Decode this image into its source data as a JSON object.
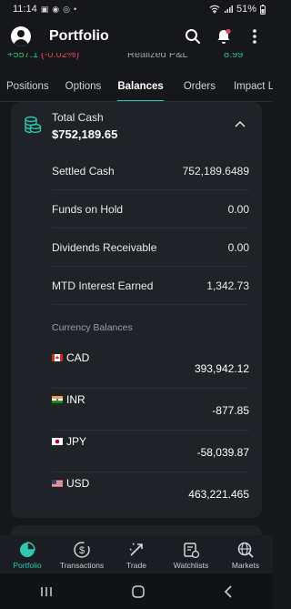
{
  "status_bar": {
    "time": "11:14",
    "battery": "51%"
  },
  "header": {
    "title": "Portfolio"
  },
  "ticker": {
    "gain": "+557.1",
    "pct": "(-0.02%)",
    "label": "Realized P&L",
    "value": "8.99"
  },
  "tabs": [
    {
      "label": "Positions"
    },
    {
      "label": "Options"
    },
    {
      "label": "Balances"
    },
    {
      "label": "Orders"
    },
    {
      "label": "Impact Len"
    }
  ],
  "balances": {
    "total_label": "Total Cash",
    "total_value": "$752,189.65",
    "rows": [
      {
        "label": "Settled Cash",
        "value": "752,189.6489"
      },
      {
        "label": "Funds on Hold",
        "value": "0.00"
      },
      {
        "label": "Dividends Receivable",
        "value": "0.00"
      },
      {
        "label": "MTD Interest Earned",
        "value": "1,342.73"
      }
    ],
    "currency_section_label": "Currency Balances",
    "currencies": [
      {
        "code": "CAD",
        "amount": "393,942.12"
      },
      {
        "code": "INR",
        "amount": "-877.85"
      },
      {
        "code": "JPY",
        "amount": "-58,039.87"
      },
      {
        "code": "USD",
        "amount": "463,221.465"
      }
    ]
  },
  "bottom_nav": [
    {
      "label": "Portfolio",
      "icon": "pie-chart-icon"
    },
    {
      "label": "Transactions",
      "icon": "dollar-circle-icon"
    },
    {
      "label": "Trade",
      "icon": "trade-arrows-icon"
    },
    {
      "label": "Watchlists",
      "icon": "watchlist-icon"
    },
    {
      "label": "Markets",
      "icon": "globe-search-icon"
    }
  ],
  "colors": {
    "accent": "#2ec9b0",
    "positive": "#2ec27e",
    "negative": "#e0445a",
    "background": "#15171b",
    "card": "#1f2227"
  }
}
